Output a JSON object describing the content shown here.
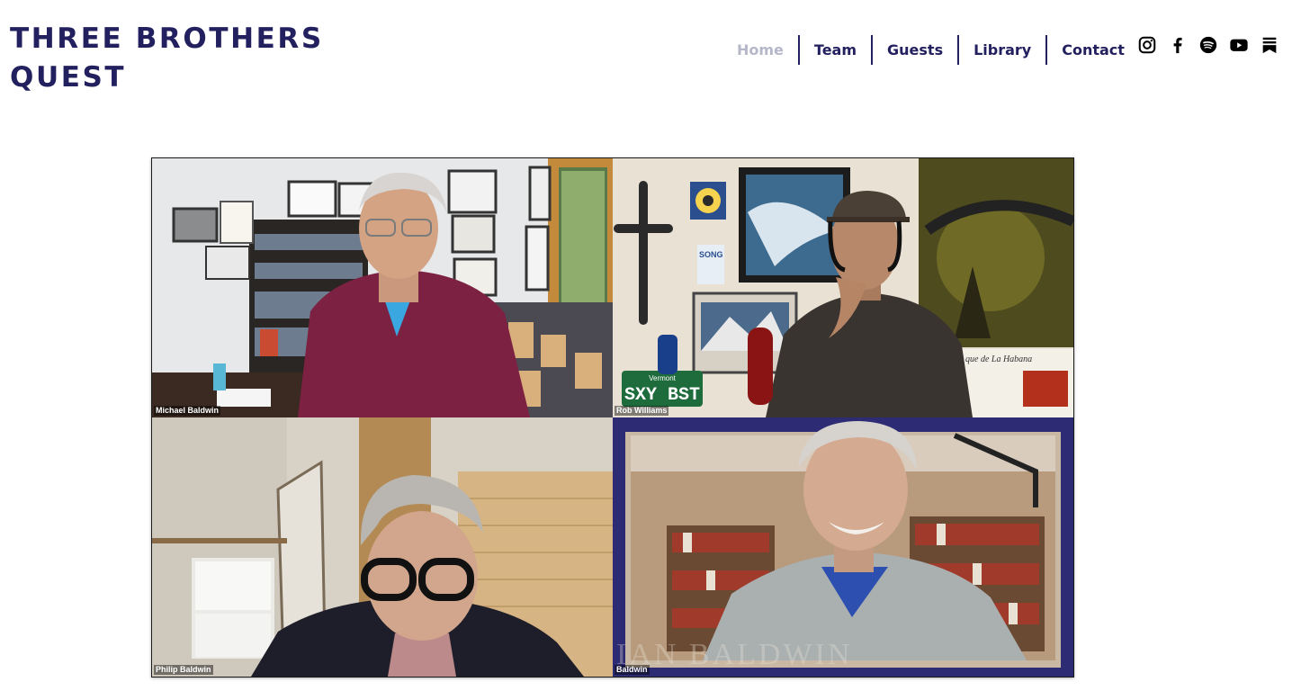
{
  "site": {
    "title_line1": "THREE BROTHERS",
    "title_line2": "QUEST"
  },
  "nav": {
    "items": [
      "Home",
      "Team",
      "Guests",
      "Library",
      "Contact"
    ],
    "active": "Home"
  },
  "social": {
    "icons": [
      "instagram-icon",
      "facebook-icon",
      "spotify-icon",
      "youtube-icon",
      "substack-icon"
    ]
  },
  "video": {
    "participants": [
      {
        "name": "Michael Baldwin"
      },
      {
        "name": "Rob Williams"
      },
      {
        "name": "Philip Baldwin"
      },
      {
        "name": "Baldwin"
      }
    ],
    "watermark": "IAN BALDWIN",
    "scene_text": {
      "license_plate_state": "Vermont",
      "license_plate": "SXY BST",
      "poster_label": "SONG",
      "wall_text": "que de La Habana"
    }
  },
  "colors": {
    "brand": "#23205f",
    "nav_active": "#b6b7c9",
    "tile_frame": "#2d2b74"
  }
}
